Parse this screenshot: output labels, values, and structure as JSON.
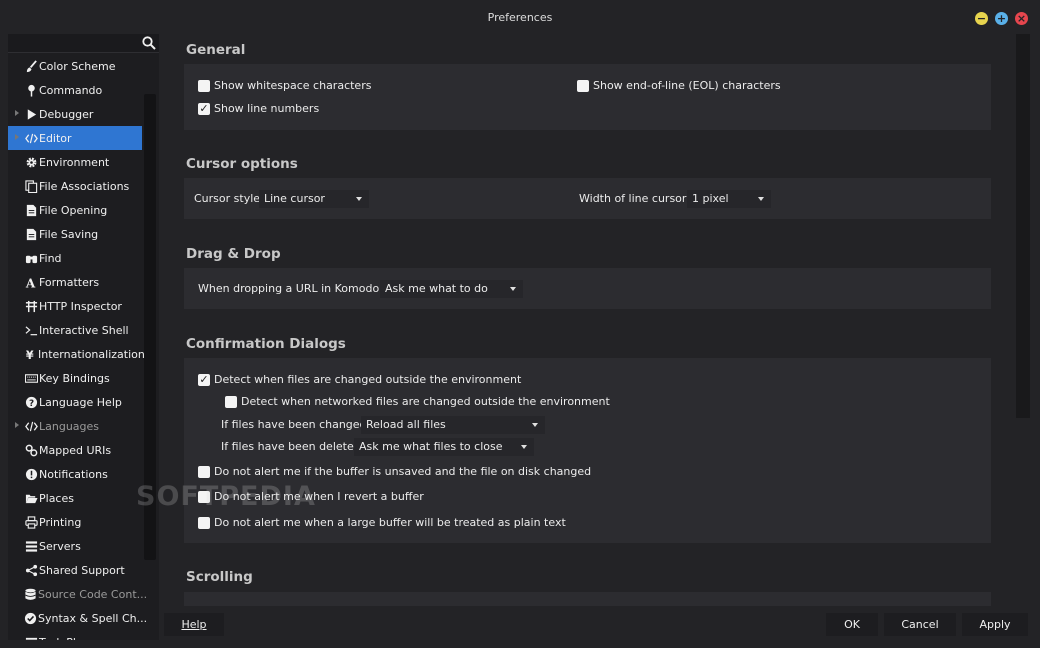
{
  "window": {
    "title": "Preferences"
  },
  "sidebar": {
    "items": [
      {
        "label": "Color Scheme",
        "icon": "brush-icon",
        "twisty": false,
        "selected": false,
        "dim": false
      },
      {
        "label": "Commando",
        "icon": "pin-icon",
        "twisty": false,
        "selected": false,
        "dim": false
      },
      {
        "label": "Debugger",
        "icon": "play-icon",
        "twisty": true,
        "selected": false,
        "dim": false
      },
      {
        "label": "Editor",
        "icon": "code-icon",
        "twisty": true,
        "selected": true,
        "dim": false
      },
      {
        "label": "Environment",
        "icon": "gear-icon",
        "twisty": false,
        "selected": false,
        "dim": false
      },
      {
        "label": "File Associations",
        "icon": "files-icon",
        "twisty": false,
        "selected": false,
        "dim": false
      },
      {
        "label": "File Opening",
        "icon": "file-icon",
        "twisty": false,
        "selected": false,
        "dim": false
      },
      {
        "label": "File Saving",
        "icon": "file-save-icon",
        "twisty": false,
        "selected": false,
        "dim": false
      },
      {
        "label": "Find",
        "icon": "binoculars-icon",
        "twisty": false,
        "selected": false,
        "dim": false
      },
      {
        "label": "Formatters",
        "icon": "font-icon",
        "twisty": false,
        "selected": false,
        "dim": false
      },
      {
        "label": "HTTP Inspector",
        "icon": "network-icon",
        "twisty": false,
        "selected": false,
        "dim": false
      },
      {
        "label": "Interactive Shell",
        "icon": "terminal-icon",
        "twisty": false,
        "selected": false,
        "dim": false
      },
      {
        "label": "Internationalization",
        "icon": "yen-icon",
        "twisty": false,
        "selected": false,
        "dim": false
      },
      {
        "label": "Key Bindings",
        "icon": "keyboard-icon",
        "twisty": false,
        "selected": false,
        "dim": false
      },
      {
        "label": "Language Help",
        "icon": "help-circle-icon",
        "twisty": false,
        "selected": false,
        "dim": false
      },
      {
        "label": "Languages",
        "icon": "code-icon",
        "twisty": true,
        "selected": false,
        "dim": true
      },
      {
        "label": "Mapped URIs",
        "icon": "link-icon",
        "twisty": false,
        "selected": false,
        "dim": false
      },
      {
        "label": "Notifications",
        "icon": "alert-circle-icon",
        "twisty": false,
        "selected": false,
        "dim": false
      },
      {
        "label": "Places",
        "icon": "folder-open-icon",
        "twisty": false,
        "selected": false,
        "dim": false
      },
      {
        "label": "Printing",
        "icon": "printer-icon",
        "twisty": false,
        "selected": false,
        "dim": false
      },
      {
        "label": "Servers",
        "icon": "server-icon",
        "twisty": false,
        "selected": false,
        "dim": false
      },
      {
        "label": "Shared Support",
        "icon": "share-icon",
        "twisty": false,
        "selected": false,
        "dim": false
      },
      {
        "label": "Source Code Cont...",
        "icon": "database-icon",
        "twisty": false,
        "selected": false,
        "dim": true
      },
      {
        "label": "Syntax & Spell Ch...",
        "icon": "check-circle-icon",
        "twisty": false,
        "selected": false,
        "dim": false
      },
      {
        "label": "Task Plann...",
        "icon": "tasks-icon",
        "twisty": false,
        "selected": false,
        "dim": false
      }
    ]
  },
  "general": {
    "title": "General",
    "show_whitespace": {
      "label": "Show whitespace characters",
      "checked": false
    },
    "show_eol": {
      "label": "Show end-of-line (EOL) characters",
      "checked": false
    },
    "show_line_numbers": {
      "label": "Show line numbers",
      "checked": true
    }
  },
  "cursor": {
    "title": "Cursor options",
    "style_label": "Cursor style:",
    "style_value": "Line cursor",
    "width_label": "Width of line cursor:",
    "width_value": "1 pixel"
  },
  "dragdrop": {
    "title": "Drag & Drop",
    "url_label": "When dropping a URL in Komodo:",
    "url_value": "Ask me what to do"
  },
  "confirm": {
    "title": "Confirmation Dialogs",
    "detect_changed": {
      "label": "Detect when files are changed outside the environment",
      "checked": true
    },
    "detect_networked": {
      "label": "Detect when networked files are changed outside the environment",
      "checked": false
    },
    "changed_label": "If files have been changed:",
    "changed_value": "Reload all files",
    "deleted_label": "If files have been deleted:",
    "deleted_value": "Ask me what files to close",
    "no_alert_unsaved": {
      "label": "Do not alert me if the buffer is unsaved and the file on disk changed",
      "checked": false
    },
    "no_alert_revert": {
      "label": "Do not alert me when I revert a buffer",
      "checked": false
    },
    "no_alert_large": {
      "label": "Do not alert me when a large buffer will be treated as plain text",
      "checked": false
    }
  },
  "scrolling": {
    "title": "Scrolling"
  },
  "watermark": "SOFTPEDIA",
  "buttons": {
    "help": "Help",
    "ok": "OK",
    "cancel": "Cancel",
    "apply": "Apply"
  }
}
